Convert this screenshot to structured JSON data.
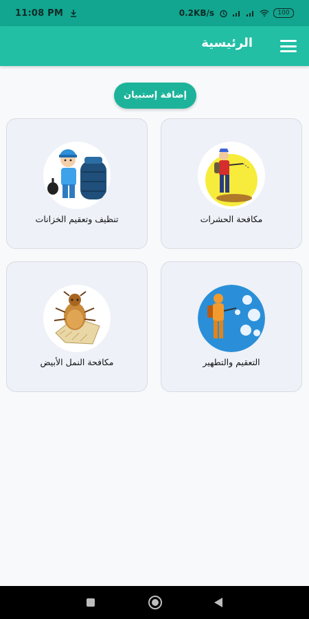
{
  "status_bar": {
    "time": "11:08 PM",
    "speed": "0.2KB/s",
    "battery": "100",
    "icons": [
      "download-icon",
      "alarm-icon",
      "signal-icon",
      "signal-icon",
      "wifi-icon",
      "battery-icon"
    ]
  },
  "app_bar": {
    "title": "الرئيسية",
    "menu_icon": "hamburger-menu-icon",
    "color": "#22bfa5"
  },
  "add_button": {
    "label": "إضافة إستبيان",
    "color": "#1db39b"
  },
  "services": [
    {
      "label": "مكافحة الحشرات",
      "icon": "pest-control-worker-icon"
    },
    {
      "label": "تنظيف وتعقيم الخزانات",
      "icon": "tank-cleaning-worker-icon"
    },
    {
      "label": "التعقيم والتطهير",
      "icon": "disinfection-worker-icon"
    },
    {
      "label": "مكافحة النمل الأبيض",
      "icon": "termite-icon"
    }
  ],
  "nav_bar": {
    "icons": [
      "recent-apps-icon",
      "home-icon",
      "back-icon"
    ]
  }
}
